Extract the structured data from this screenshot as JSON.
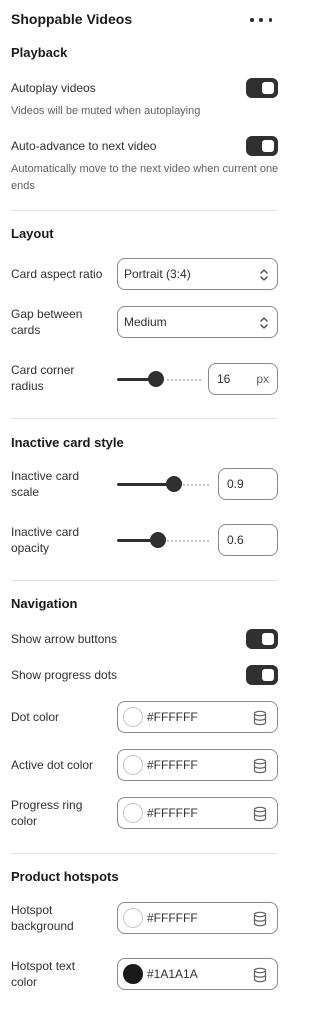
{
  "panel": {
    "title": "Shoppable Videos",
    "more_icon": "more-horizontal-icon"
  },
  "playback": {
    "title": "Playback",
    "autoplay": {
      "label": "Autoplay videos",
      "help": "Videos will be muted when autoplaying",
      "on": true
    },
    "auto_advance": {
      "label": "Auto-advance to next video",
      "help": "Automatically move to the next video when current one ends",
      "on": true
    }
  },
  "layout": {
    "title": "Layout",
    "aspect_ratio": {
      "label": "Card aspect ratio",
      "value": "Portrait (3:4)"
    },
    "gap": {
      "label": "Gap between cards",
      "value": "Medium"
    },
    "corner_radius": {
      "label": "Card corner radius",
      "value": "16",
      "unit": "px",
      "slider_fraction": 0.45
    }
  },
  "inactive": {
    "title": "Inactive card style",
    "scale": {
      "label": "Inactive card scale",
      "value": "0.9",
      "slider_fraction": 0.64
    },
    "opacity": {
      "label": "Inactive card opacity",
      "value": "0.6",
      "slider_fraction": 0.44
    }
  },
  "navigation": {
    "title": "Navigation",
    "show_arrows": {
      "label": "Show arrow buttons",
      "on": true
    },
    "show_dots": {
      "label": "Show progress dots",
      "on": true
    },
    "dot_color": {
      "label": "Dot color",
      "value": "#FFFFFF",
      "swatch": "#FFFFFF"
    },
    "active_dot_color": {
      "label": "Active dot color",
      "value": "#FFFFFF",
      "swatch": "#FFFFFF"
    },
    "progress_ring_color": {
      "label": "Progress ring color",
      "value": "#FFFFFF",
      "swatch": "#FFFFFF"
    }
  },
  "hotspots": {
    "title": "Product hotspots",
    "background": {
      "label": "Hotspot background",
      "value": "#FFFFFF",
      "swatch": "#FFFFFF"
    },
    "text_color": {
      "label": "Hotspot text color",
      "value": "#1A1A1A",
      "swatch": "#1A1A1A"
    }
  }
}
